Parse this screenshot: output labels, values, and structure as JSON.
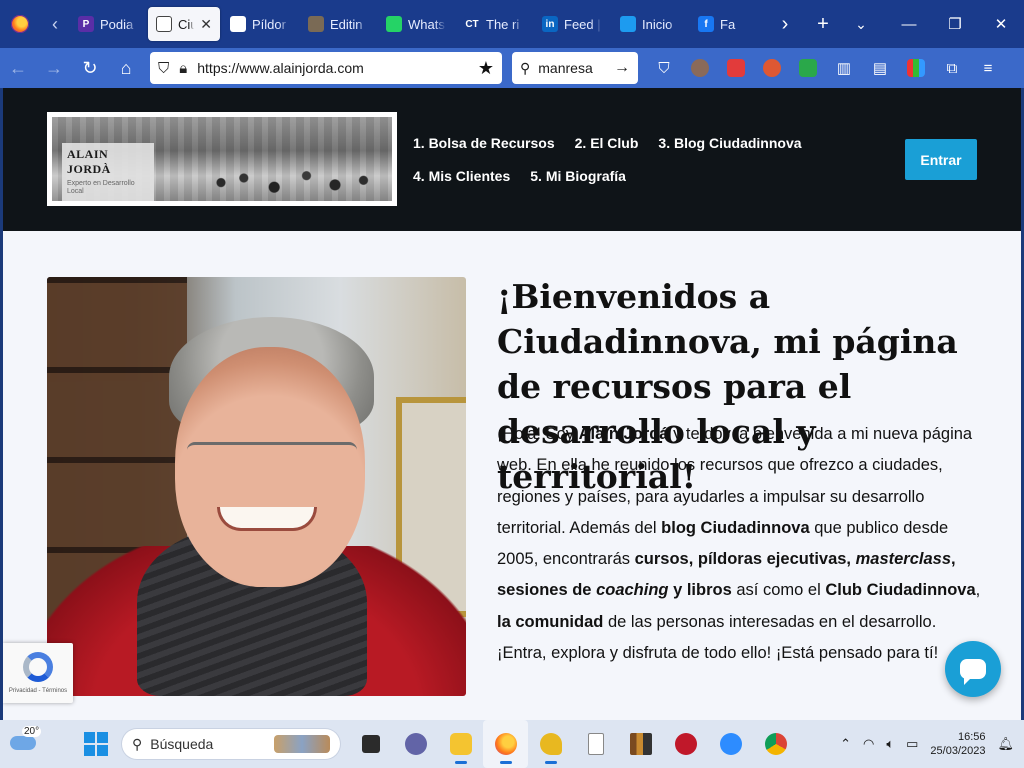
{
  "browser": {
    "tabs": [
      {
        "title": "Podia",
        "icon": "podia-icon",
        "color": "#5a2ea6",
        "glyph": "P"
      },
      {
        "title": "Ciu",
        "icon": "site-icon",
        "color": "#ffffff",
        "glyph": "",
        "active": true
      },
      {
        "title": "Píldor",
        "icon": "site-icon",
        "color": "#ffffff",
        "glyph": ""
      },
      {
        "title": "Editin",
        "icon": "image-icon",
        "color": "#7a6a55",
        "glyph": ""
      },
      {
        "title": "Whats",
        "icon": "whatsapp-icon",
        "color": "#25d366",
        "glyph": ""
      },
      {
        "title": "The ri",
        "icon": "ct-icon",
        "color": "#1a3b8c",
        "glyph": "CT"
      },
      {
        "title": "Feed |",
        "icon": "linkedin-icon",
        "color": "#0a66c2",
        "glyph": "in"
      },
      {
        "title": "Inicio",
        "icon": "twitter-icon",
        "color": "#1d9bf0",
        "glyph": ""
      },
      {
        "title": "Fa",
        "icon": "facebook-icon",
        "color": "#1877f2",
        "glyph": "f"
      }
    ],
    "url": "https://www.alainjorda.com",
    "search_value": "manresa"
  },
  "site": {
    "logo": {
      "name": "ALAIN JORDÀ",
      "tagline": "Experto en Desarrollo Local"
    },
    "menu": [
      [
        "1. Bolsa de Recursos",
        "2. El Club",
        "3. Blog Ciudadinnova"
      ],
      [
        "4. Mis Clientes",
        "5. Mi Biografía"
      ]
    ],
    "enter_label": "Entrar",
    "hero": {
      "title": "¡Bienvenidos a Ciudadinnova, mi página de recursos para el desarrollo local y territorial!",
      "text": {
        "p1": "¡Hola! Soy ",
        "name": "Alain Jordá",
        "p2": " y te doy la bienvenida a mi nueva página web. En ella he reunido los recursos que ofrezco a ciudades, regiones y países, para ayudarles a impulsar su desarrollo territorial. Además del ",
        "blog": "blog Ciudadinnova",
        "p3": " que publico desde 2005, encontrarás ",
        "cursos": "cursos, píldoras ejecutivas, ",
        "masterclass": "masterclass",
        "sesiones": ", sesiones de ",
        "coaching": "coaching",
        "libros": " y libros",
        "p4": " así como el ",
        "club": "Club Ciudadinnova",
        "p5": ", ",
        "comunidad": "la comunidad",
        "p6": " de las personas interesadas en el desarrollo. ¡Entra, explora y disfruta de todo ello! ¡Está pensado para tí!"
      }
    },
    "recaptcha_text": "Privacidad - Términos"
  },
  "taskbar": {
    "temperature": "20°",
    "search_placeholder": "Búsqueda",
    "time": "16:56",
    "date": "25/03/2023"
  }
}
